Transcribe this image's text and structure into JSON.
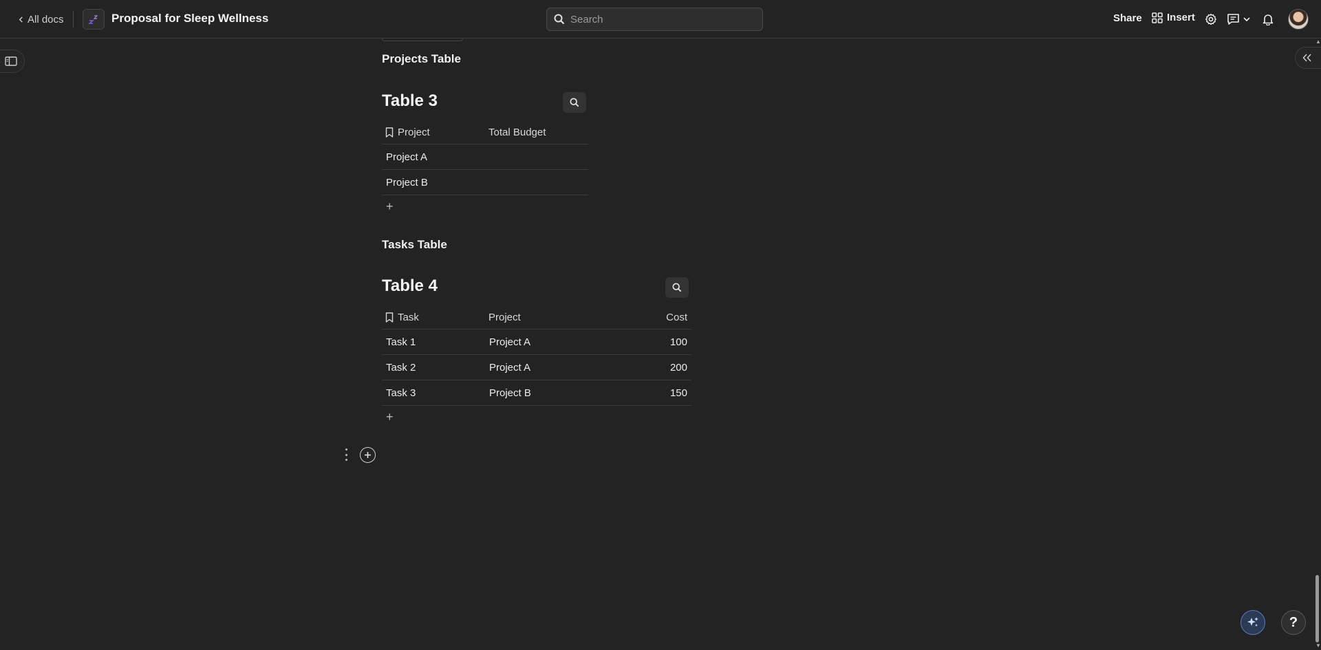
{
  "topbar": {
    "back_label": "All docs",
    "doc_title": "Proposal for Sleep Wellness",
    "search_placeholder": "Search",
    "share_label": "Share",
    "insert_label": "Insert"
  },
  "sections": {
    "projects_heading": "Projects Table",
    "tasks_heading": "Tasks Table"
  },
  "table3": {
    "title": "Table 3",
    "columns": [
      "Project",
      "Total Budget"
    ],
    "rows": [
      [
        "Project A",
        ""
      ],
      [
        "Project B",
        ""
      ]
    ],
    "add_row": "+"
  },
  "table4": {
    "title": "Table 4",
    "columns": [
      "Task",
      "Project",
      "Cost"
    ],
    "rows": [
      [
        "Task 1",
        "Project A",
        "100"
      ],
      [
        "Task 2",
        "Project A",
        "200"
      ],
      [
        "Task 3",
        "Project B",
        "150"
      ]
    ],
    "add_row": "+"
  },
  "help_label": "?",
  "colors": {
    "background": "#232323",
    "ai_accent": "#5a7bbf",
    "doc_icon_accent": "#7b5cd6"
  }
}
